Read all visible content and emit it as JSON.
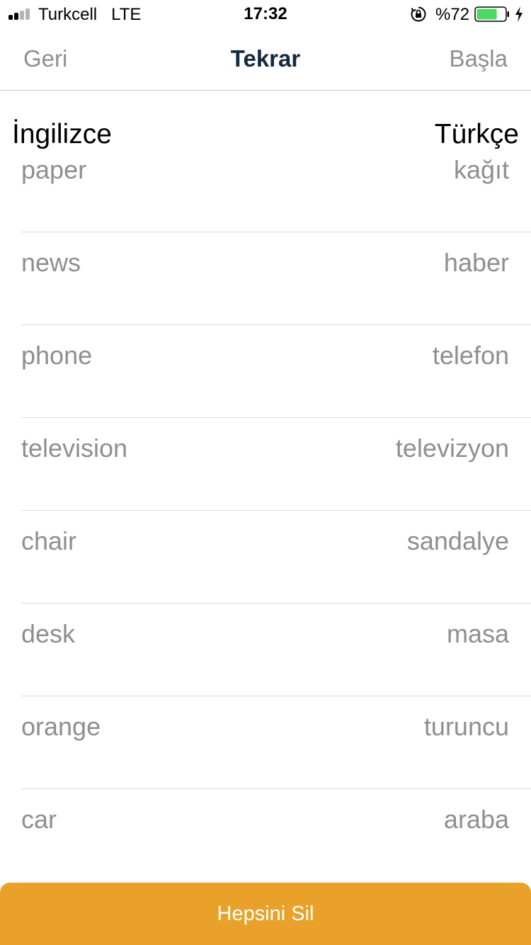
{
  "status_bar": {
    "carrier": "Turkcell",
    "network": "LTE",
    "time": "17:32",
    "battery_percent": "%72",
    "battery_level": 0.72,
    "signal_bars_filled": 2,
    "signal_bars_total": 4,
    "icons": [
      "signal-icon",
      "orientation-lock-icon",
      "battery-icon",
      "charging-bolt-icon"
    ]
  },
  "nav": {
    "back_label": "Geri",
    "title": "Tekrar",
    "start_label": "Başla"
  },
  "columns": {
    "left": "İngilizce",
    "right": "Türkçe"
  },
  "words": [
    {
      "en": "paper",
      "tr": "kağıt"
    },
    {
      "en": "news",
      "tr": "haber"
    },
    {
      "en": "phone",
      "tr": "telefon"
    },
    {
      "en": "television",
      "tr": "televizyon"
    },
    {
      "en": "chair",
      "tr": "sandalye"
    },
    {
      "en": "desk",
      "tr": "masa"
    },
    {
      "en": "orange",
      "tr": "turuncu"
    },
    {
      "en": "car",
      "tr": "araba"
    }
  ],
  "footer": {
    "delete_all_label": "Hepsini Sil"
  },
  "colors": {
    "accent": "#e9a12a",
    "title": "#13293d",
    "muted_text": "#8e8e93",
    "battery_fill": "#4cd964"
  }
}
